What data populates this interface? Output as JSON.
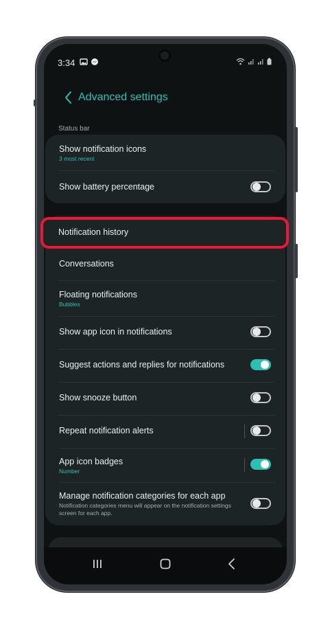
{
  "status_bar": {
    "time": "3:34",
    "left_icons": [
      "gallery-icon",
      "messenger-icon"
    ],
    "right_icons": [
      "wifi-icon",
      "signal-icon",
      "signal-icon",
      "battery-icon"
    ]
  },
  "header": {
    "title": "Advanced settings",
    "back_icon": "chevron-left-icon"
  },
  "section_status_bar": {
    "label": "Status bar"
  },
  "status_bar_card": {
    "items": [
      {
        "label": "Show notification icons",
        "sub": "3 most recent"
      },
      {
        "label": "Show battery percentage",
        "toggle": "off"
      }
    ]
  },
  "notification_history": {
    "label": "Notification history",
    "highlight_color": "#e8193a"
  },
  "notifications_card": {
    "items": [
      {
        "label": "Conversations"
      },
      {
        "label": "Floating notifications",
        "sub": "Bubbles"
      },
      {
        "label": "Show app icon in notifications",
        "toggle": "off"
      },
      {
        "label": "Suggest actions and replies for notifications",
        "toggle": "on"
      },
      {
        "label": "Show snooze button",
        "toggle": "off"
      },
      {
        "label": "Repeat notification alerts",
        "toggle": "off"
      },
      {
        "label": "App icon badges",
        "sub": "Number",
        "toggle": "on"
      },
      {
        "label": "Manage notification categories for each app",
        "desc": "Notification categories menu will appear on the notification settings screen for each app.",
        "toggle": "off"
      }
    ]
  },
  "nav_bar": {
    "icons": [
      "recents-icon",
      "home-icon",
      "back-icon"
    ]
  },
  "colors": {
    "accent": "#2fbfb4",
    "background": "#0f1213",
    "card": "#1d2425",
    "toggle_on": "#2cc0b4"
  }
}
